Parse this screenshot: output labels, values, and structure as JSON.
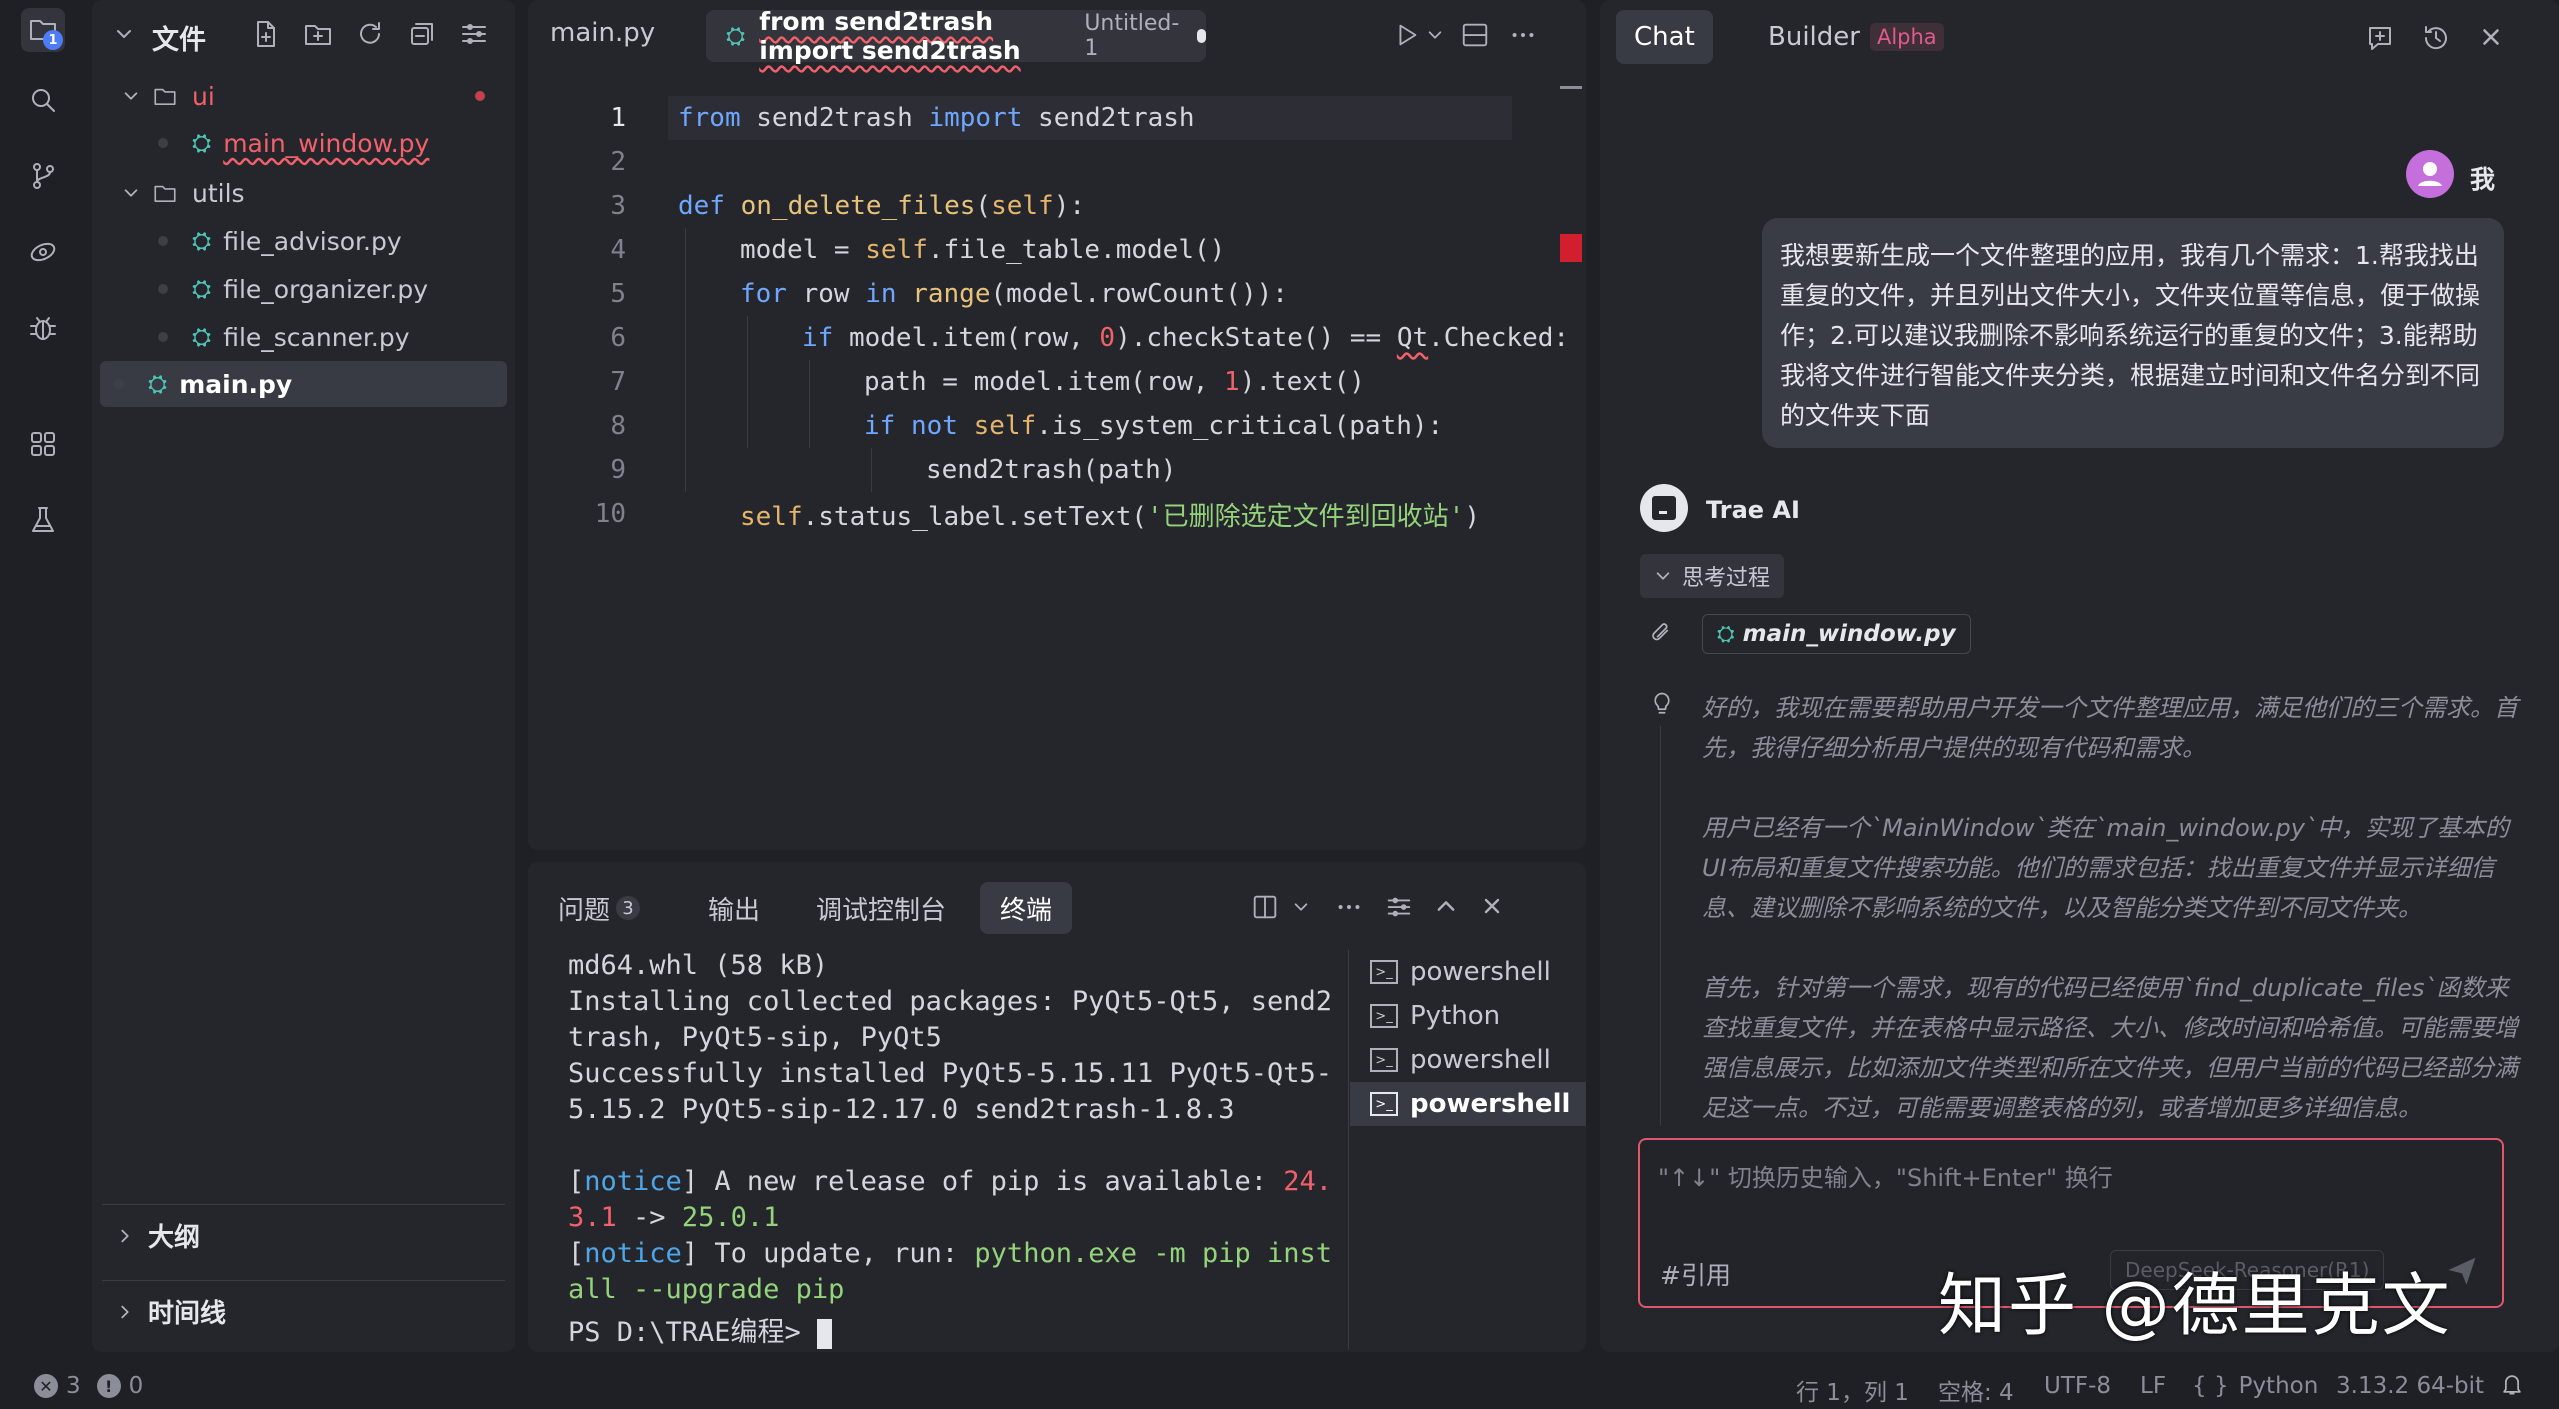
{
  "activity": {
    "files_badge": "1"
  },
  "explorer": {
    "title": "文件",
    "tree": {
      "ui": "ui",
      "main_window": "main_window.py",
      "utils": "utils",
      "file_advisor": "file_advisor.py",
      "file_organizer": "file_organizer.py",
      "file_scanner": "file_scanner.py",
      "main": "main.py"
    },
    "outline": "大纲",
    "timeline": "时间线"
  },
  "editor": {
    "tab_main": "main.py",
    "tab_active": "from send2trash import send2trash",
    "tab_active_sub": "Untitled-1",
    "lines": [
      "1",
      "2",
      "3",
      "4",
      "5",
      "6",
      "7",
      "8",
      "9",
      "10"
    ],
    "code": {
      "l1a": "from",
      "l1b": " send2trash ",
      "l1c": "import",
      "l1d": " send2trash",
      "l3a": "def",
      "l3b": " on_delete_files",
      "l3c": "(",
      "l3d": "self",
      "l3e": "):",
      "l4a": "model = ",
      "l4b": "self",
      "l4c": ".file_table.model()",
      "l5a": "for",
      "l5b": " row ",
      "l5c": "in",
      "l5d": " range",
      "l5e": "(model.rowCount()):",
      "l6a": "if",
      "l6b": " model.item(row, ",
      "l6c": "0",
      "l6d": ").checkState() == ",
      "l6e": "Qt",
      "l6f": ".Checked:",
      "l7a": "path = model.item(row, ",
      "l7b": "1",
      "l7c": ").text()",
      "l8a": "if not ",
      "l8b": "self",
      "l8c": ".is_system_critical(path):",
      "l9a": "send2trash(path)",
      "l10a": "self",
      "l10b": ".status_label.setText(",
      "l10c": "'已删除选定文件到回收站'",
      "l10d": ")"
    }
  },
  "panel": {
    "tabs": {
      "problems": "问题",
      "problems_count": "3",
      "output": "输出",
      "debug": "调试控制台",
      "terminal": "终端"
    },
    "terminal": {
      "t1": "md64.whl (58 kB)",
      "t2": "Installing collected packages: PyQt5-Qt5, send2",
      "t3": "trash, PyQt5-sip, PyQt5",
      "t4": "Successfully installed PyQt5-5.15.11 PyQt5-Qt5-",
      "t5": "5.15.2 PyQt5-sip-12.17.0 send2trash-1.8.3",
      "t6a": "[",
      "t6b": "notice",
      "t6c": "] A new release of pip is available: ",
      "t6d": "24.",
      "t7a": "3.1",
      "t7b": " -> ",
      "t7c": "25.0.1",
      "t8a": "[",
      "t8b": "notice",
      "t8c": "] To update, run: ",
      "t8d": "python.exe -m pip inst",
      "t9": "all --upgrade pip",
      "t10": "PS D:\\TRAE编程> "
    },
    "shells": [
      "powershell",
      "Python",
      "powershell",
      "powershell"
    ]
  },
  "chat": {
    "tab_chat": "Chat",
    "tab_builder": "Builder",
    "alpha": "Alpha",
    "user_name": "我",
    "user_message": "我想要新生成一个文件整理的应用，我有几个需求：1.帮我找出重复的文件，并且列出文件大小，文件夹位置等信息，便于做操作；2.可以建议我删除不影响系统运行的重复的文件；3.能帮助我将文件进行智能文件夹分类，根据建立时间和文件名分到不同的文件夹下面",
    "ai_name": "Trae AI",
    "thinking_label": "思考过程",
    "attached_file": "main_window.py",
    "think_p1": "好的，我现在需要帮助用户开发一个文件整理应用，满足他们的三个需求。首先，我得仔细分析用户提供的现有代码和需求。",
    "think_p2": "用户已经有一个`MainWindow`类在`main_window.py`中，实现了基本的UI布局和重复文件搜索功能。他们的需求包括：找出重复文件并显示详细信息、建议删除不影响系统的文件，以及智能分类文件到不同文件夹。",
    "think_p3": "首先，针对第一个需求，现有的代码已经使用`find_duplicate_files`函数来查找重复文件，并在表格中显示路径、大小、修改时间和哈希值。可能需要增强信息展示，比如添加文件类型和所在文件夹，但用户当前的代码已经部分满足这一点。不过，可能需要调整表格的列，或者增加更多详细信息。",
    "input_placeholder": "\"↑↓\" 切换历史输入，\"Shift+Enter\" 换行",
    "quote": "#引用",
    "model_hint": "DeepSeek-Reasoner(R1)",
    "watermark": "知乎 @德里克文"
  },
  "status": {
    "errors": "3",
    "warnings": "0",
    "position": "行 1，列 1",
    "spaces": "空格: 4",
    "encoding": "UTF-8",
    "eol": "LF",
    "language": "Python",
    "version": "3.13.2 64-bit"
  }
}
